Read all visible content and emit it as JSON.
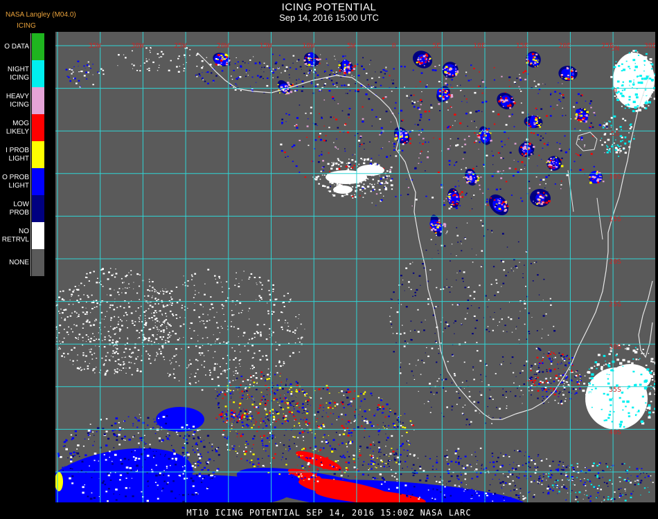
{
  "header": {
    "source": "NASA Langley (M04.0)",
    "product": "ICING",
    "title": "ICING POTENTIAL",
    "timestamp": "Sep 14, 2016 15:00 UTC"
  },
  "legend": [
    {
      "label_lines": [
        "O DATA"
      ],
      "color": "#1fb51f"
    },
    {
      "label_lines": [
        "NIGHT",
        "ICING"
      ],
      "color": "#00f0f0"
    },
    {
      "label_lines": [
        "HEAVY",
        "ICING"
      ],
      "color": "#e4a3d6"
    },
    {
      "label_lines": [
        "MOG",
        "LIKELY"
      ],
      "color": "#ff0000"
    },
    {
      "label_lines": [
        "I PROB",
        "LIGHT"
      ],
      "color": "#ffff00"
    },
    {
      "label_lines": [
        "O PROB",
        "LIGHT"
      ],
      "color": "#0000ff"
    },
    {
      "label_lines": [
        "LOW",
        "PROB"
      ],
      "color": "#000080"
    },
    {
      "label_lines": [
        "NO",
        "RETRVL"
      ],
      "color": "#ffffff"
    },
    {
      "label_lines": [
        "NONE"
      ],
      "color": "#5a5a5a"
    }
  ],
  "map": {
    "grid_color": "#2fd6d6",
    "coastline_color": "#e8e8e8",
    "label_color": "#c62828",
    "lon_labels": [
      "35W",
      "30W",
      "25W",
      "20W",
      "15W",
      "10W",
      "5W",
      "0",
      "5E",
      "10E",
      "15E",
      "20E",
      "25E",
      "30E",
      "35E"
    ],
    "lat_labels": [
      "5N",
      "0",
      "5S",
      "10S",
      "15S",
      "20S",
      "25S",
      "30S",
      "35S",
      "40S"
    ]
  },
  "footer": "MT10  ICING POTENTIAL   SEP 14, 2016 15:00Z  NASA LARC"
}
